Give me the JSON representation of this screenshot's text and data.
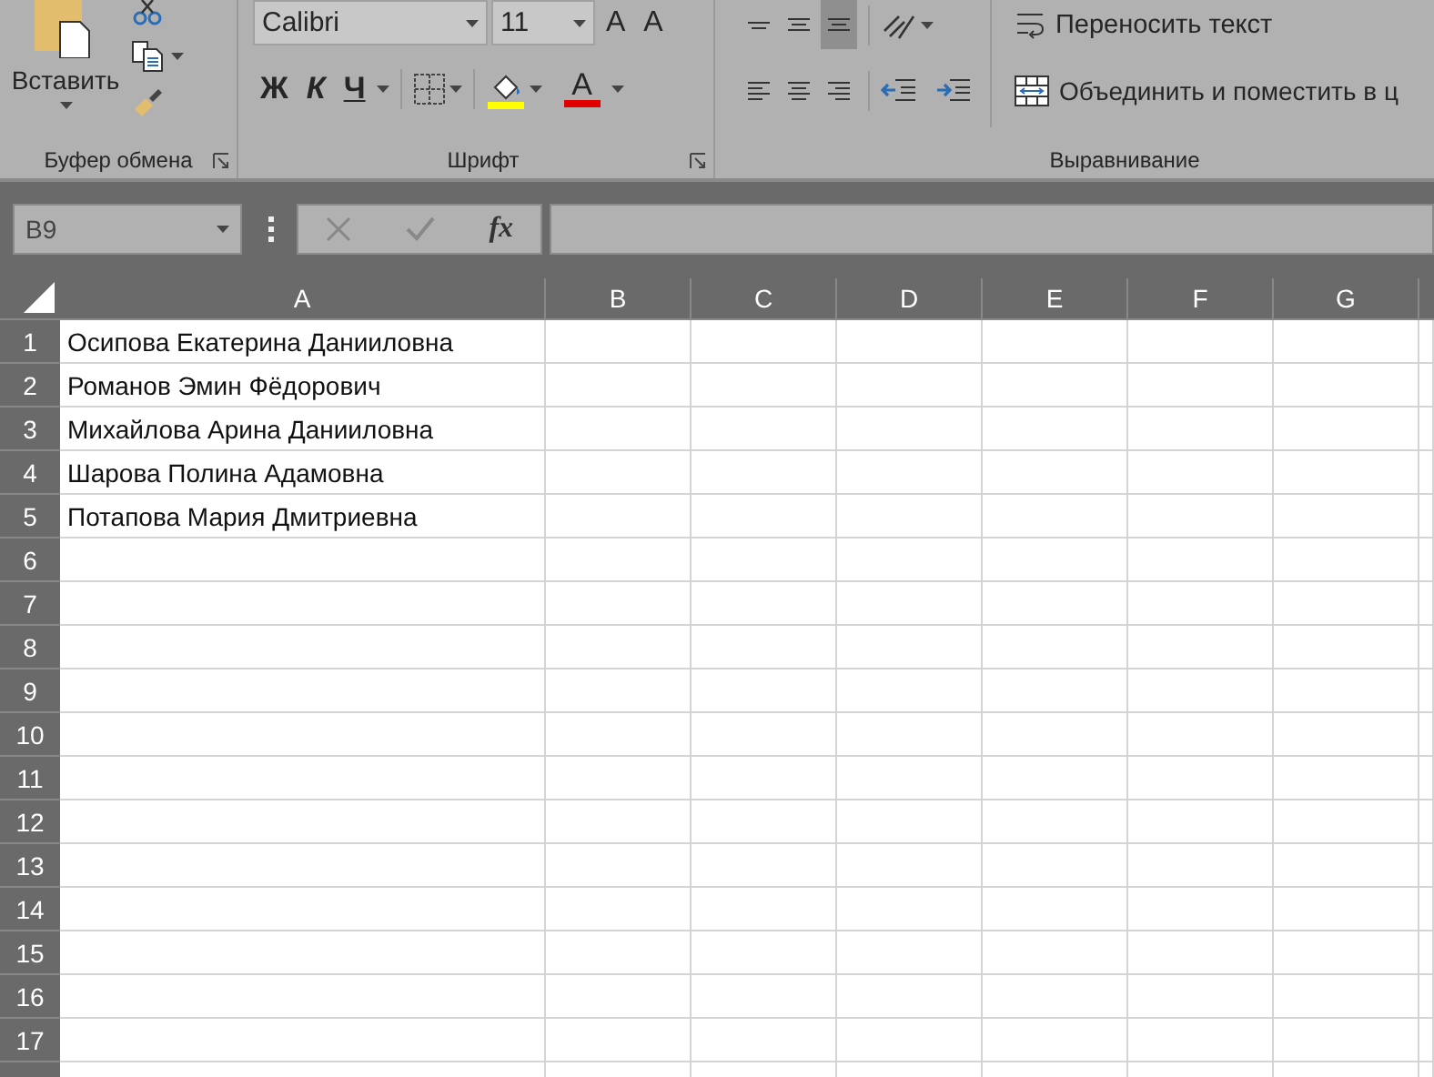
{
  "ribbon": {
    "clipboard": {
      "paste_label": "Вставить",
      "group_label": "Буфер обмена"
    },
    "font": {
      "font_name": "Calibri",
      "font_size": "11",
      "grow_font": "A",
      "shrink_font": "A",
      "bold": "Ж",
      "italic": "К",
      "underline": "Ч",
      "font_color": "A",
      "group_label": "Шрифт"
    },
    "alignment": {
      "vertical_align": [
        {
          "kind": "top",
          "selected": false
        },
        {
          "kind": "middle",
          "selected": false
        },
        {
          "kind": "bottom",
          "selected": true
        }
      ],
      "horizontal_align": [
        {
          "kind": "left",
          "selected": false
        },
        {
          "kind": "center",
          "selected": false
        },
        {
          "kind": "right",
          "selected": false
        }
      ],
      "wrap_text": "Переносить текст",
      "merge": "Объединить и поместить в ц",
      "group_label": "Выравнивание"
    }
  },
  "formula_bar": {
    "name_box": "B9",
    "function_label": "fx"
  },
  "sheet": {
    "columns": [
      "A",
      "B",
      "C",
      "D",
      "E",
      "F",
      "G"
    ],
    "rows": [
      {
        "number": "1",
        "cells": [
          "Осипова Екатерина Данииловна"
        ]
      },
      {
        "number": "2",
        "cells": [
          "Романов Эмин Фёдорович"
        ]
      },
      {
        "number": "3",
        "cells": [
          "Михайлова Арина Данииловна"
        ]
      },
      {
        "number": "4",
        "cells": [
          "Шарова Полина Адамовна"
        ]
      },
      {
        "number": "5",
        "cells": [
          "Потапова Мария Дмитриевна"
        ]
      },
      {
        "number": "6",
        "cells": []
      },
      {
        "number": "7",
        "cells": []
      },
      {
        "number": "8",
        "cells": []
      },
      {
        "number": "9",
        "cells": []
      },
      {
        "number": "10",
        "cells": []
      },
      {
        "number": "11",
        "cells": []
      },
      {
        "number": "12",
        "cells": []
      },
      {
        "number": "13",
        "cells": []
      },
      {
        "number": "14",
        "cells": []
      },
      {
        "number": "15",
        "cells": []
      },
      {
        "number": "16",
        "cells": []
      },
      {
        "number": "17",
        "cells": []
      }
    ]
  }
}
